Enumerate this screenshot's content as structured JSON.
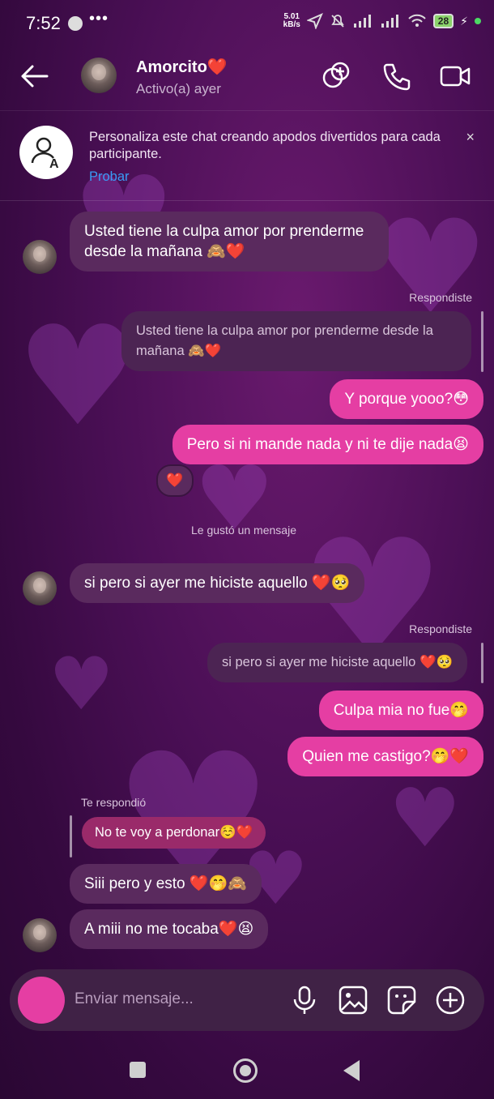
{
  "status_bar": {
    "time": "7:52",
    "more": "•••",
    "net_speed": "5.01",
    "net_unit": "kB/s",
    "battery": "28"
  },
  "header": {
    "back_label": "←",
    "contact_name": "Amorcito",
    "heart": "❤️",
    "contact_status": "Activo(a) ayer"
  },
  "banner": {
    "text": "Personaliza este chat creando apodos divertidos para cada participante.",
    "action": "Probar",
    "close": "×"
  },
  "messages": {
    "m1": "Usted tiene la culpa amor por prenderme desde la mañana 🙈❤️",
    "reply_label_1": "Respondiste",
    "quote_1": "Usted tiene la culpa amor por prenderme desde la mañana 🙈❤️",
    "m2": "Y porque yooo?😳",
    "m3": "Pero si ni mande nada y ni te dije nada😫",
    "reaction_1": "❤️",
    "liked_label": "Le gustó un mensaje",
    "m4": "si pero si ayer me hiciste aquello ❤️🥺",
    "reply_label_2": "Respondiste",
    "quote_2": "si pero si ayer me hiciste aquello ❤️🥺",
    "m5": "Culpa mia no fue🤭",
    "m6": "Quien me castigo?🤭❤️",
    "they_replied_label": "Te respondió",
    "quote_3": "No te voy a perdonar☺️❤️",
    "m7": "Siii pero y esto ❤️🤭🙈",
    "m8": "A miii no me tocaba❤️😫"
  },
  "composer": {
    "placeholder": "Enviar mensaje..."
  },
  "colors": {
    "accent": "#e53ea3",
    "link": "#3a9bf5",
    "incoming": "#5a2a5e",
    "background": "#4a0f55"
  },
  "icons": [
    "back-arrow-icon",
    "add-people-icon",
    "phone-icon",
    "video-camera-icon",
    "add-nickname-icon",
    "close-icon",
    "microphone-icon",
    "image-icon",
    "sticker-icon",
    "plus-icon",
    "camera-icon"
  ]
}
